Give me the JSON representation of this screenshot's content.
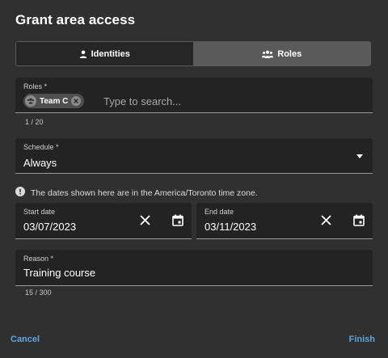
{
  "dialog": {
    "title": "Grant area access"
  },
  "toggle": {
    "identities_label": "Identities",
    "roles_label": "Roles",
    "selected": "Roles"
  },
  "roles_field": {
    "label": "Roles *",
    "chip_label": "Team C",
    "placeholder": "Type to search...",
    "counter": "1 / 20"
  },
  "schedule_field": {
    "label": "Schedule *",
    "value": "Always"
  },
  "timezone_notice": {
    "text": "The dates shown here are in the America/Toronto time zone."
  },
  "start_date": {
    "label": "Start date",
    "value": "03/07/2023"
  },
  "end_date": {
    "label": "End date",
    "value": "03/11/2023"
  },
  "reason_field": {
    "label": "Reason *",
    "value": "Training course",
    "counter": "15 / 300"
  },
  "footer": {
    "cancel_label": "Cancel",
    "finish_label": "Finish"
  },
  "colors": {
    "background": "#303030",
    "field_background": "#232323",
    "accent_link": "#5aa7e0",
    "selected_toggle": "#5a5a5a"
  }
}
